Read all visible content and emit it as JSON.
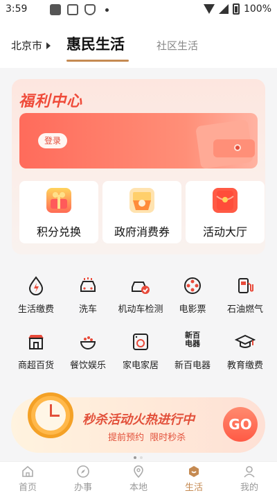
{
  "status_bar": {
    "time": "3:59",
    "battery": "100%",
    "dot": "•"
  },
  "header": {
    "city": "北京市",
    "tab_active": "惠民生活",
    "tab_inactive": "社区生活"
  },
  "welfare": {
    "title": "福利中心",
    "login_label": "登录",
    "features": [
      {
        "label": "积分兑换",
        "icon": "gift-icon"
      },
      {
        "label": "政府消费券",
        "icon": "coupon-icon"
      },
      {
        "label": "活动大厅",
        "icon": "red-envelope-icon"
      }
    ]
  },
  "services": {
    "row1": [
      {
        "label": "生活缴费",
        "icon": "drop-bolt-icon"
      },
      {
        "label": "洗车",
        "icon": "car-wash-icon"
      },
      {
        "label": "机动车检测",
        "icon": "car-check-icon"
      },
      {
        "label": "电影票",
        "icon": "film-reel-icon"
      },
      {
        "label": "石油燃气",
        "icon": "fuel-pump-icon"
      }
    ],
    "row2": [
      {
        "label": "商超百货",
        "icon": "store-icon"
      },
      {
        "label": "餐饮娱乐",
        "icon": "food-bowl-icon"
      },
      {
        "label": "家电家居",
        "icon": "washing-machine-icon"
      },
      {
        "label": "新百电器",
        "icon": "xinbai-logo-icon",
        "logo_text": "新百\n电器"
      },
      {
        "label": "教育缴费",
        "icon": "graduation-cap-icon"
      }
    ]
  },
  "promo": {
    "title": "秒杀活动火热进行中",
    "subtitle": "提前预约  限时秒杀",
    "go_label": "GO"
  },
  "tabbar": {
    "items": [
      {
        "label": "首页",
        "icon": "home-icon"
      },
      {
        "label": "办事",
        "icon": "compass-icon"
      },
      {
        "label": "本地",
        "icon": "location-pin-icon"
      },
      {
        "label": "生活",
        "icon": "life-icon",
        "active": true
      },
      {
        "label": "我的",
        "icon": "person-icon"
      }
    ]
  },
  "colors": {
    "accent": "#c58a52",
    "red": "#ef4b3a"
  }
}
